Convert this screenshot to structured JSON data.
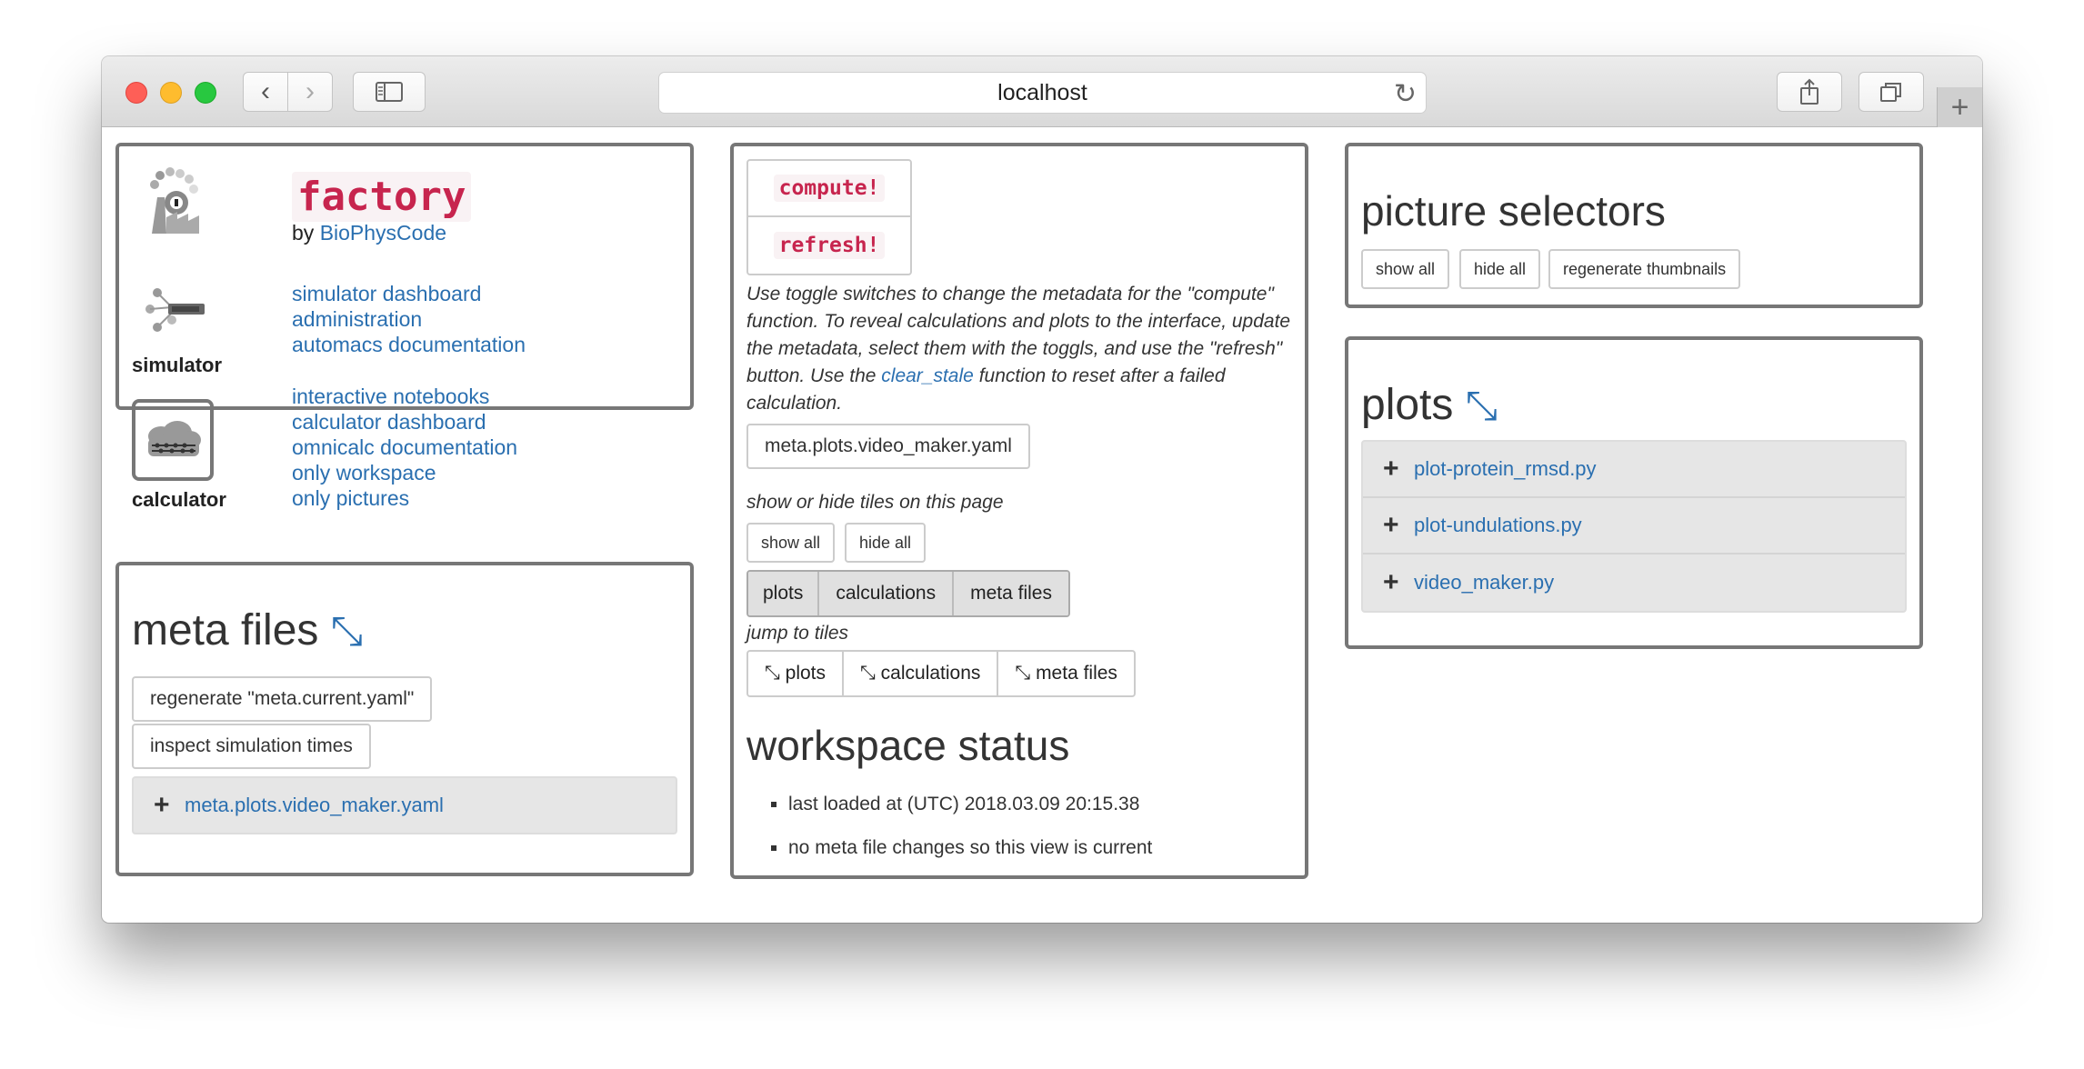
{
  "browser": {
    "url": "localhost"
  },
  "factory": {
    "title": "factory",
    "by_label": "by",
    "by_link": "BioPhysCode",
    "simulator_label": "simulator",
    "calculator_label": "calculator",
    "simulator_links": [
      "simulator dashboard",
      "administration",
      "automacs documentation"
    ],
    "calculator_links": [
      "interactive notebooks",
      "calculator dashboard",
      "omnicalc documentation",
      "only workspace",
      "only pictures"
    ]
  },
  "meta_files": {
    "title": "meta files",
    "regenerate_button": "regenerate \"meta.current.yaml\"",
    "inspect_button": "inspect simulation times",
    "items": [
      "meta.plots.video_maker.yaml"
    ]
  },
  "controls": {
    "compute_button": "compute!",
    "refresh_button": "refresh!",
    "instructions_before": "Use toggle switches to change the metadata for the \"compute\" function. To reveal calculations and plots to the interface, update the metadata, select them with the toggls, and use the \"refresh\" button. Use the",
    "instructions_link": "clear_stale",
    "instructions_after": "function to reset after a failed calculation.",
    "meta_file_button": "meta.plots.video_maker.yaml",
    "show_hide_label": "show or hide tiles on this page",
    "show_all": "show all",
    "hide_all": "hide all",
    "tile_toggles": [
      "plots",
      "calculations",
      "meta files"
    ],
    "jump_label": "jump to tiles",
    "jump_buttons": [
      "plots",
      "calculations",
      "meta files"
    ]
  },
  "workspace_status": {
    "title": "workspace status",
    "items": [
      "last loaded at (UTC) 2018.03.09 20:15.38",
      "no meta file changes so this view is current"
    ]
  },
  "picture_selectors": {
    "title": "picture selectors",
    "buttons": [
      "show all",
      "hide all",
      "regenerate thumbnails"
    ]
  },
  "plots": {
    "title": "plots",
    "items": [
      "plot-protein_rmsd.py",
      "plot-undulations.py",
      "video_maker.py"
    ]
  }
}
